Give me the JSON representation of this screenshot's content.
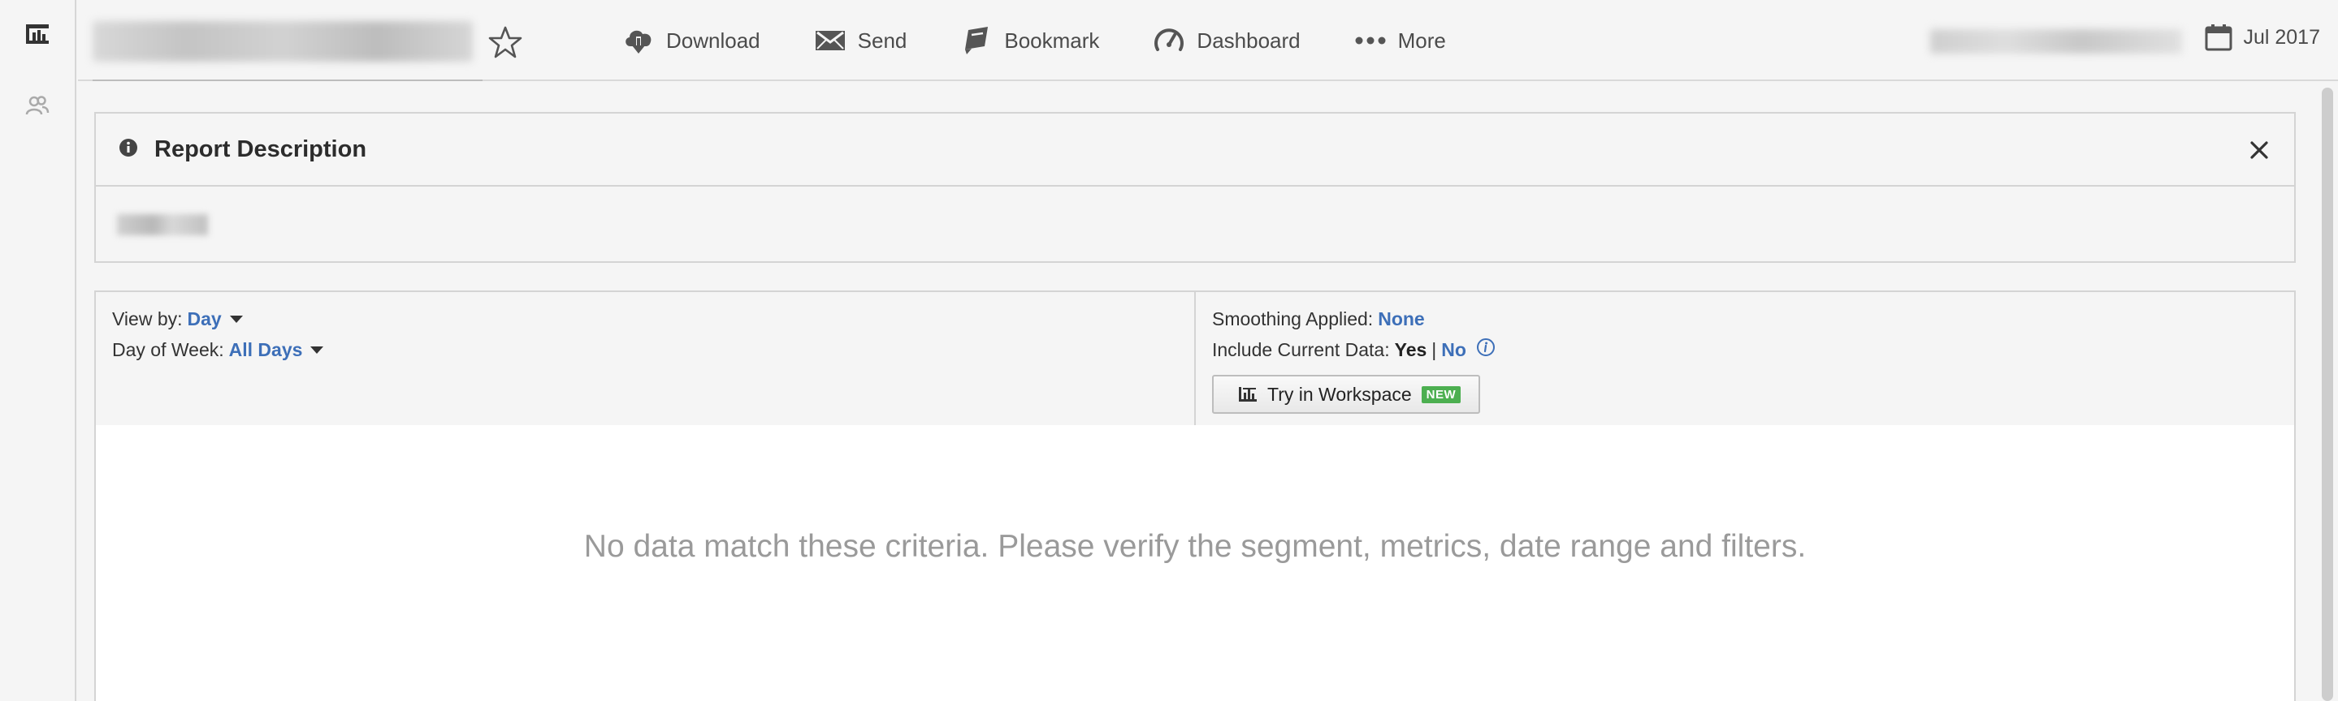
{
  "icons": {
    "rail_top": "reports-icon",
    "rail_second": "users-icon",
    "favorite": "star-icon",
    "download": "cloud-download-icon",
    "send": "envelope-icon",
    "bookmark": "bookmark-icon",
    "dashboard": "gauge-icon",
    "more": "ellipsis-icon",
    "calendar": "calendar-icon",
    "info": "info-icon",
    "close": "close-icon",
    "help": "help-icon",
    "workspace": "workspace-icon"
  },
  "toolbar": {
    "download_label": "Download",
    "send_label": "Send",
    "bookmark_label": "Bookmark",
    "dashboard_label": "Dashboard",
    "more_label": "More",
    "date_label": "Jul 2017"
  },
  "description": {
    "title": "Report Description"
  },
  "controls": {
    "view_by_label": "View by:",
    "view_by_value": "Day",
    "day_of_week_label": "Day of Week:",
    "day_of_week_value": "All Days",
    "smoothing_label": "Smoothing Applied:",
    "smoothing_value": "None",
    "include_current_label": "Include Current Data:",
    "include_yes": "Yes",
    "include_sep": "|",
    "include_no": "No",
    "workspace_button_label": "Try in Workspace",
    "workspace_badge": "NEW"
  },
  "results": {
    "empty_message": "No data match these criteria. Please verify the segment, metrics, date range and filters."
  },
  "colors": {
    "link_blue": "#3d6fb8",
    "badge_green": "#4caf50",
    "muted_text": "#9a9a9a"
  }
}
